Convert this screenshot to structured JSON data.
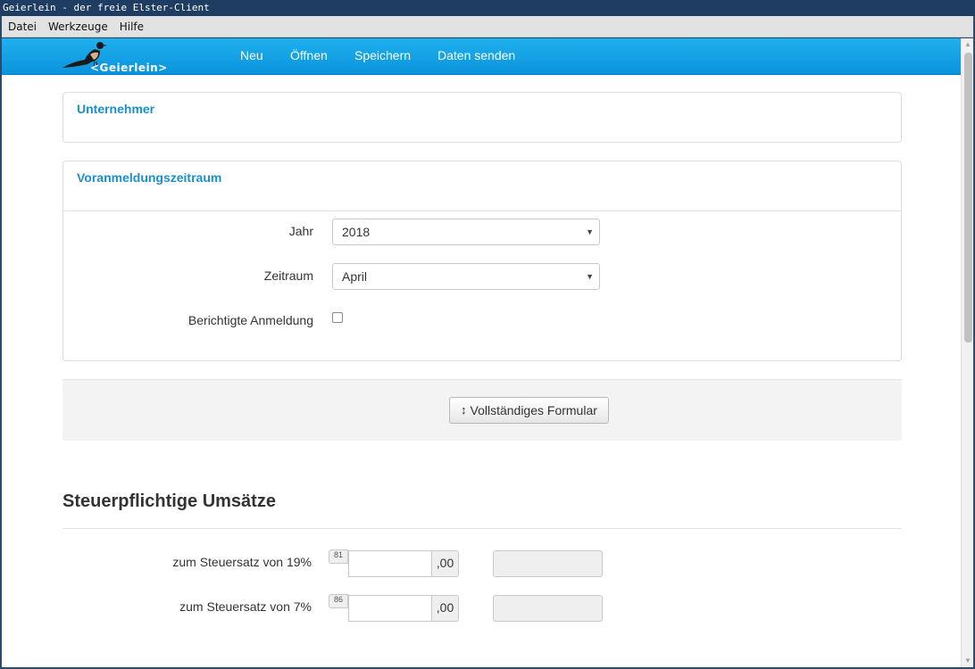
{
  "window": {
    "title": "Geierlein - der freie Elster-Client"
  },
  "menubar": {
    "items": [
      "Datei",
      "Werkzeuge",
      "Hilfe"
    ]
  },
  "navbar": {
    "brand_text": "<Geierlein>",
    "links": [
      "Neu",
      "Öffnen",
      "Speichern",
      "Daten senden"
    ]
  },
  "unternehmer": {
    "title": "Unternehmer"
  },
  "zeitraum": {
    "title": "Voranmeldungszeitraum",
    "jahr_label": "Jahr",
    "jahr_value": "2018",
    "zeitraum_label": "Zeitraum",
    "zeitraum_value": "April",
    "berichtigt_label": "Berichtigte Anmeldung",
    "berichtigt_checked": false
  },
  "actions": {
    "full_form_label": "Vollständiges Formular"
  },
  "umsaetze": {
    "title": "Steuerpflichtige Umsätze",
    "rows": [
      {
        "label": "zum Steuersatz von 19%",
        "kennzahl": "81",
        "suffix": ",00",
        "value": ""
      },
      {
        "label": "zum Steuersatz von 7%",
        "kennzahl": "86",
        "suffix": ",00",
        "value": ""
      }
    ]
  },
  "colors": {
    "navbar": "#1fb0ee",
    "panel_title": "#1a8fcf",
    "titlebar": "#1f3d63"
  }
}
